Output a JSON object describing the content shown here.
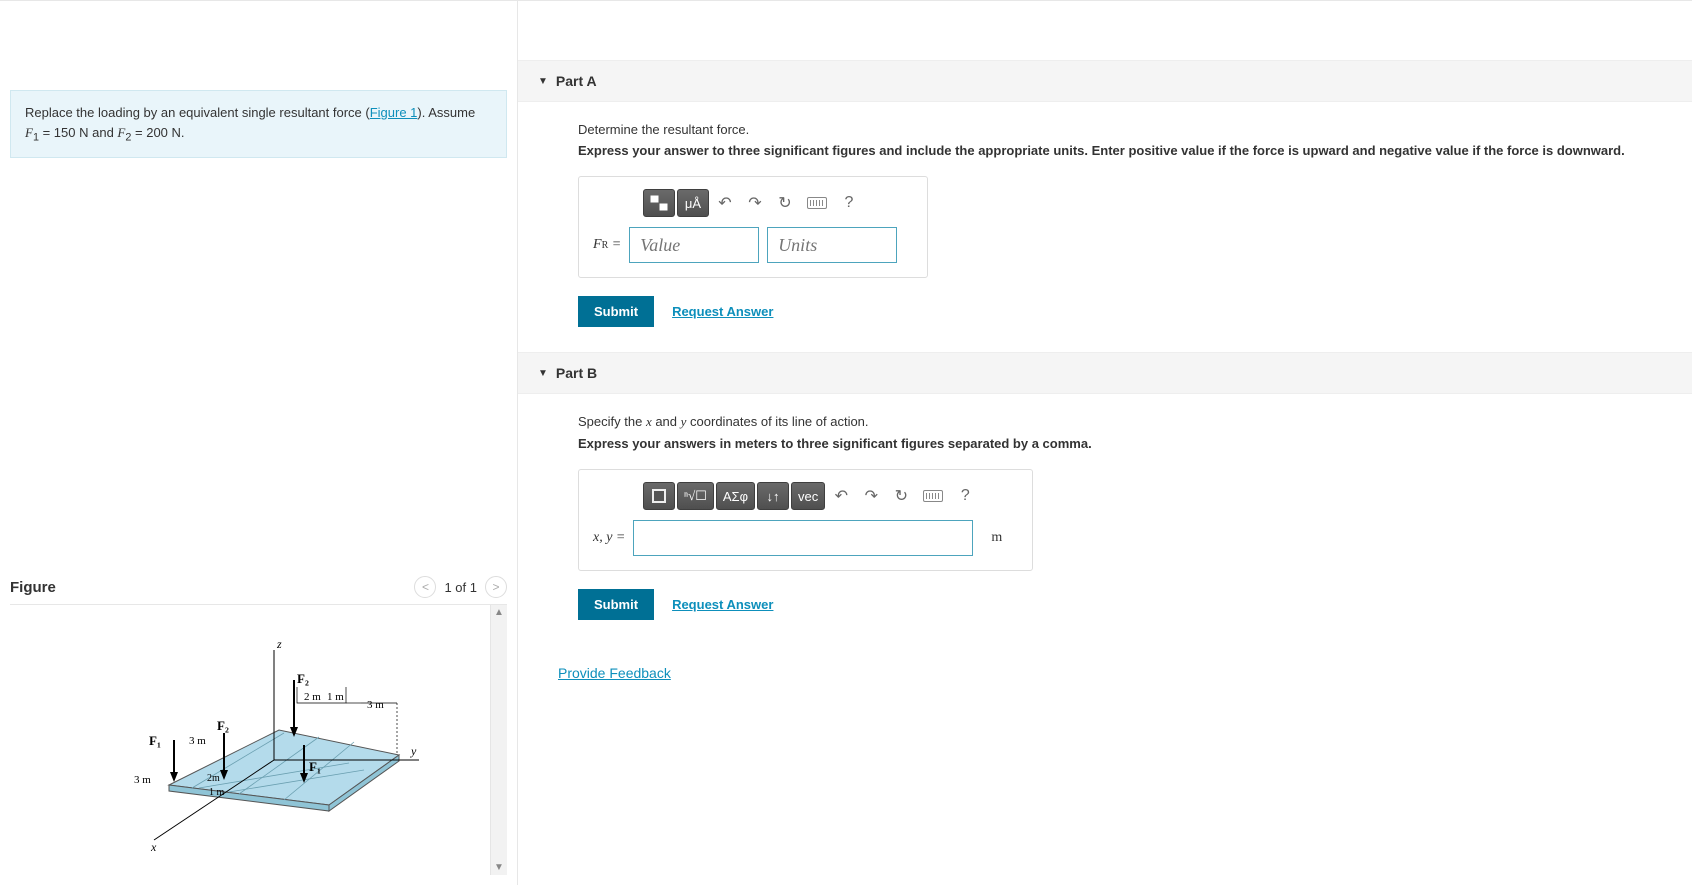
{
  "problem": {
    "text_prefix": "Replace the loading by an equivalent single resultant force (",
    "figure_link": "Figure 1",
    "text_suffix": "). Assume ",
    "f1_label": "F",
    "f1_sub": "1",
    "f1_val": " = 150 N",
    "and": " and ",
    "f2_label": "F",
    "f2_sub": "2",
    "f2_val": " = 200 N."
  },
  "figure": {
    "title": "Figure",
    "counter": "1 of 1"
  },
  "partA": {
    "title": "Part A",
    "prompt": "Determine the resultant force.",
    "instruction": "Express your answer to three significant figures and include the appropriate units. Enter positive value if the force is upward and negative value if the force is downward.",
    "label": "F",
    "label_sub": "R",
    "eq": " = ",
    "value_ph": "Value",
    "units_ph": "Units",
    "toolbar": {
      "units": "μÅ",
      "help": "?"
    },
    "submit": "Submit",
    "request": "Request Answer"
  },
  "partB": {
    "title": "Part B",
    "prompt_prefix": "Specify the ",
    "var_x": "x",
    "prompt_and": " and ",
    "var_y": "y",
    "prompt_suffix": " coordinates of its line of action.",
    "instruction": "Express your answers in meters to three significant figures separated by a comma.",
    "label": "x, y = ",
    "unit": "m",
    "toolbar": {
      "greek": "ΑΣφ",
      "vec": "vec",
      "help": "?"
    },
    "submit": "Submit",
    "request": "Request Answer"
  },
  "feedback": "Provide Feedback",
  "diagram": {
    "axes": {
      "x": "x",
      "y": "y",
      "z": "z"
    },
    "forces": {
      "F1": "F₁",
      "F2": "F₂"
    },
    "dims": {
      "d3m": "3 m",
      "d2m": "2 m",
      "d1m": "1 m"
    }
  }
}
